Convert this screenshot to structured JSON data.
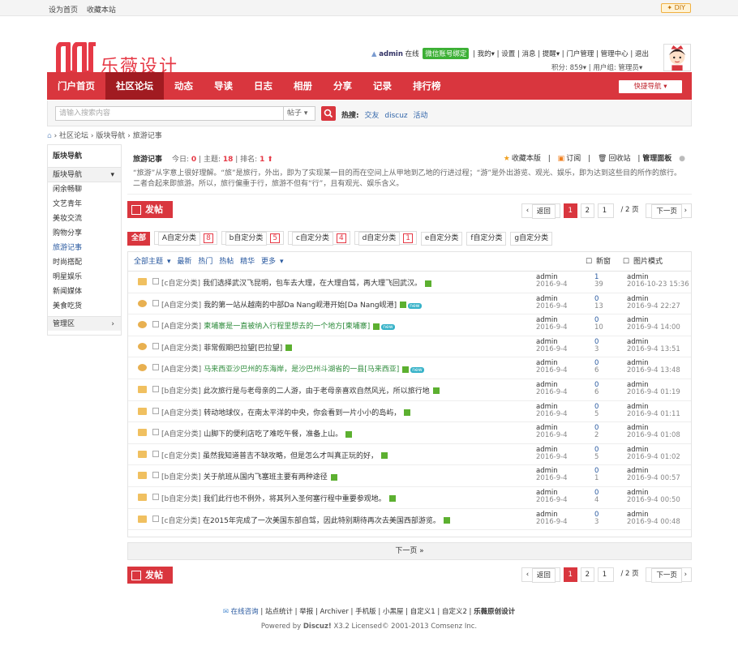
{
  "topbar": {
    "set_home": "设为首页",
    "bookmark": "收藏本站",
    "diy": "DIY"
  },
  "logo": {
    "text": "乐薇设计",
    "color": "#e63946"
  },
  "user": {
    "name": "admin",
    "status": "在线",
    "wechat": "微信账号绑定",
    "my": "我的",
    "settings": "设置",
    "messages": "消息",
    "reminders": "提醒",
    "portal": "门户管理",
    "admin": "管理中心",
    "logout": "退出",
    "points": "积分: 859",
    "group": "用户组: 管理员"
  },
  "nav": {
    "items": [
      "门户首页",
      "社区论坛",
      "动态",
      "导读",
      "日志",
      "相册",
      "分享",
      "记录",
      "排行榜"
    ],
    "active": 1,
    "quick": "快捷导航",
    "accent": "#d9363e"
  },
  "search": {
    "placeholder": "请输入搜索内容",
    "scope": "帖子",
    "hot_label": "热搜:",
    "hot": [
      "交友",
      "discuz",
      "活动"
    ]
  },
  "breadcrumb": [
    "社区论坛",
    "版块导航",
    "旅游记事"
  ],
  "sidebar": {
    "title": "版块导航",
    "group": "版块导航",
    "items": [
      "闲余畅聊",
      "文艺青年",
      "美妆交流",
      "购物分享",
      "旅游记事",
      "时尚搭配",
      "明星娱乐",
      "新闻媒体",
      "美食吃货"
    ],
    "current": 4,
    "admin": "管理区"
  },
  "forum": {
    "name": "旅游记事",
    "today_label": "今日:",
    "today": "0",
    "topics_label": "主题:",
    "topics": "18",
    "rank_label": "排名:",
    "rank": "1",
    "fav": "收藏本版",
    "rss": "订阅",
    "recycle": "回收站",
    "manage": "管理面板",
    "desc": "“旅游”从字意上很好理解。“旅”是旅行，外出，即为了实现某一目的而在空间上从甲地到乙地的行进过程；“游”是外出游览、观光、娱乐，即为达到这些目的所作的旅行。二者合起来即旅游。所以，旅行偏重于行，旅游不但有“行”，且有观光、娱乐含义。"
  },
  "post_button": "发帖",
  "pager": {
    "back": "返回",
    "pages": [
      "1",
      "2"
    ],
    "current": "1",
    "total": "/ 2 页",
    "next": "下一页"
  },
  "types": [
    {
      "label": "全部",
      "count": ""
    },
    {
      "label": "A自定分类",
      "count": "8"
    },
    {
      "label": "b自定分类",
      "count": "5"
    },
    {
      "label": "c自定分类",
      "count": "4"
    },
    {
      "label": "d自定分类",
      "count": "1"
    },
    {
      "label": "e自定分类",
      "count": ""
    },
    {
      "label": "f自定分类",
      "count": ""
    },
    {
      "label": "g自定分类",
      "count": ""
    }
  ],
  "filter": {
    "items": [
      "全部主题",
      "最新",
      "热门",
      "热帖",
      "精华",
      "更多"
    ],
    "new_window": "新窗",
    "image_mode": "图片模式"
  },
  "threads": [
    {
      "type": "[c自定分类]",
      "title": "我们选择武汉飞昆明，包车去大理，在大理自驾，再大理飞回武汉。",
      "green": false,
      "nw": false,
      "author": "admin",
      "date": "2016-9-4",
      "replies": "1",
      "views": "39",
      "last": "admin",
      "last_date": "2016-10-23 15:36",
      "hot": false
    },
    {
      "type": "[A自定分类]",
      "title": "我的第一站从越南的中部Da Nang岘港开始[Da Nang岘港]",
      "green": false,
      "nw": true,
      "author": "admin",
      "date": "2016-9-4",
      "replies": "0",
      "views": "13",
      "last": "admin",
      "last_date": "2016-9-4 22:27",
      "hot": true
    },
    {
      "type": "[A自定分类]",
      "title": "柬埔寨是一直被纳入行程里想去的一个地方[柬埔寨]",
      "green": true,
      "nw": true,
      "author": "admin",
      "date": "2016-9-4",
      "replies": "0",
      "views": "10",
      "last": "admin",
      "last_date": "2016-9-4 14:00",
      "hot": true
    },
    {
      "type": "[A自定分类]",
      "title": "菲常假期巴拉望[巴拉望]",
      "green": false,
      "nw": false,
      "author": "admin",
      "date": "2016-9-4",
      "replies": "0",
      "views": "3",
      "last": "admin",
      "last_date": "2016-9-4 13:51",
      "hot": true
    },
    {
      "type": "[A自定分类]",
      "title": "马来西亚沙巴州的东海岸，是沙巴州斗湖省的一县[马来西亚]",
      "green": true,
      "nw": true,
      "author": "admin",
      "date": "2016-9-4",
      "replies": "0",
      "views": "6",
      "last": "admin",
      "last_date": "2016-9-4 13:48",
      "hot": true
    },
    {
      "type": "[b自定分类]",
      "title": "此次旅行是与老母亲的二人游，由于老母亲喜欢自然风光，所以旅行地",
      "green": false,
      "nw": false,
      "author": "admin",
      "date": "2016-9-4",
      "replies": "0",
      "views": "6",
      "last": "admin",
      "last_date": "2016-9-4 01:19",
      "hot": false
    },
    {
      "type": "[A自定分类]",
      "title": "转动地球仪，在南太平洋的中央，你会看到一片小小的岛屿，",
      "green": false,
      "nw": false,
      "author": "admin",
      "date": "2016-9-4",
      "replies": "0",
      "views": "5",
      "last": "admin",
      "last_date": "2016-9-4 01:11",
      "hot": false
    },
    {
      "type": "[A自定分类]",
      "title": "山脚下的便利店吃了难吃午餐，准备上山。",
      "green": false,
      "nw": false,
      "author": "admin",
      "date": "2016-9-4",
      "replies": "0",
      "views": "2",
      "last": "admin",
      "last_date": "2016-9-4 01:08",
      "hot": false
    },
    {
      "type": "[c自定分类]",
      "title": "虽然我知道普吉不缺攻略，但是怎么才叫真正玩的好，",
      "green": false,
      "nw": false,
      "author": "admin",
      "date": "2016-9-4",
      "replies": "0",
      "views": "5",
      "last": "admin",
      "last_date": "2016-9-4 01:02",
      "hot": false
    },
    {
      "type": "[b自定分类]",
      "title": "关于航班从国内飞塞班主要有两种途径",
      "green": false,
      "nw": false,
      "author": "admin",
      "date": "2016-9-4",
      "replies": "0",
      "views": "1",
      "last": "admin",
      "last_date": "2016-9-4 00:57",
      "hot": false
    },
    {
      "type": "[b自定分类]",
      "title": "我们此行也不例外，将其列入圣何塞行程中重要参观地。",
      "green": false,
      "nw": false,
      "author": "admin",
      "date": "2016-9-4",
      "replies": "0",
      "views": "4",
      "last": "admin",
      "last_date": "2016-9-4 00:50",
      "hot": false
    },
    {
      "type": "[c自定分类]",
      "title": "在2015年完成了一次美国东部自驾，因此特别期待再次去美国西部游览。",
      "green": false,
      "nw": false,
      "author": "admin",
      "date": "2016-9-4",
      "replies": "0",
      "views": "3",
      "last": "admin",
      "last_date": "2016-9-4 00:48",
      "hot": false
    }
  ],
  "next_page": "下一页 »",
  "footer": {
    "online": "在线咨询",
    "links": [
      "站点统计",
      "举报",
      "Archiver",
      "手机版",
      "小黑屋",
      "自定义1",
      "自定义2",
      "乐薇原创设计"
    ],
    "powered_prefix": "Powered by",
    "brand": "Discuz!",
    "powered_suffix": "X3.2 Licensed© 2001-2013 Comsenz Inc."
  }
}
